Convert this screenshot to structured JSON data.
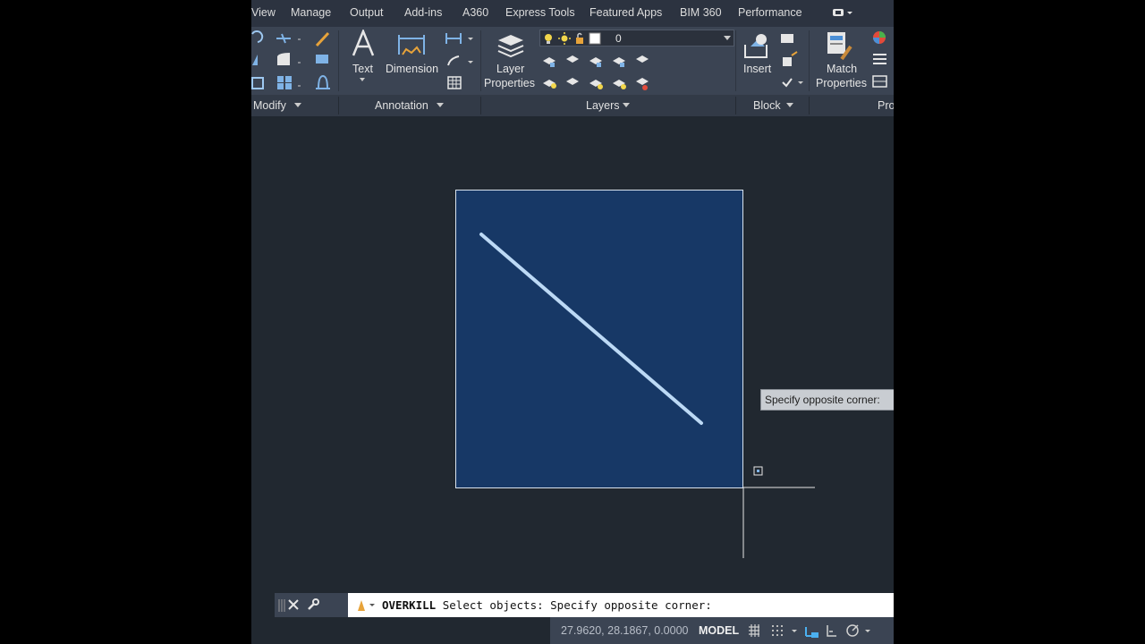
{
  "tabs": [
    "View",
    "Manage",
    "Output",
    "Add-ins",
    "A360",
    "Express Tools",
    "Featured Apps",
    "BIM 360",
    "Performance"
  ],
  "ribbon": {
    "panels": [
      "Modify",
      "Annotation",
      "Layers",
      "Block",
      "Pro"
    ],
    "buttons": {
      "text": "Text",
      "dimension": "Dimension",
      "layer_properties_1": "Layer",
      "layer_properties_2": "Properties",
      "insert": "Insert",
      "match_properties_1": "Match",
      "match_properties_2": "Properties"
    },
    "current_layer": "0"
  },
  "tooltip": "Specify opposite corner:",
  "command_line": {
    "command": "OVERKILL",
    "prompt": "Select objects: Specify opposite corner:"
  },
  "statusbar": {
    "coordinates": "27.9620, 28.1867, 0.0000",
    "space": "MODEL"
  },
  "colors": {
    "selection_window": "#173866",
    "canvas": "#212830",
    "ribbon": "#3b4453"
  }
}
